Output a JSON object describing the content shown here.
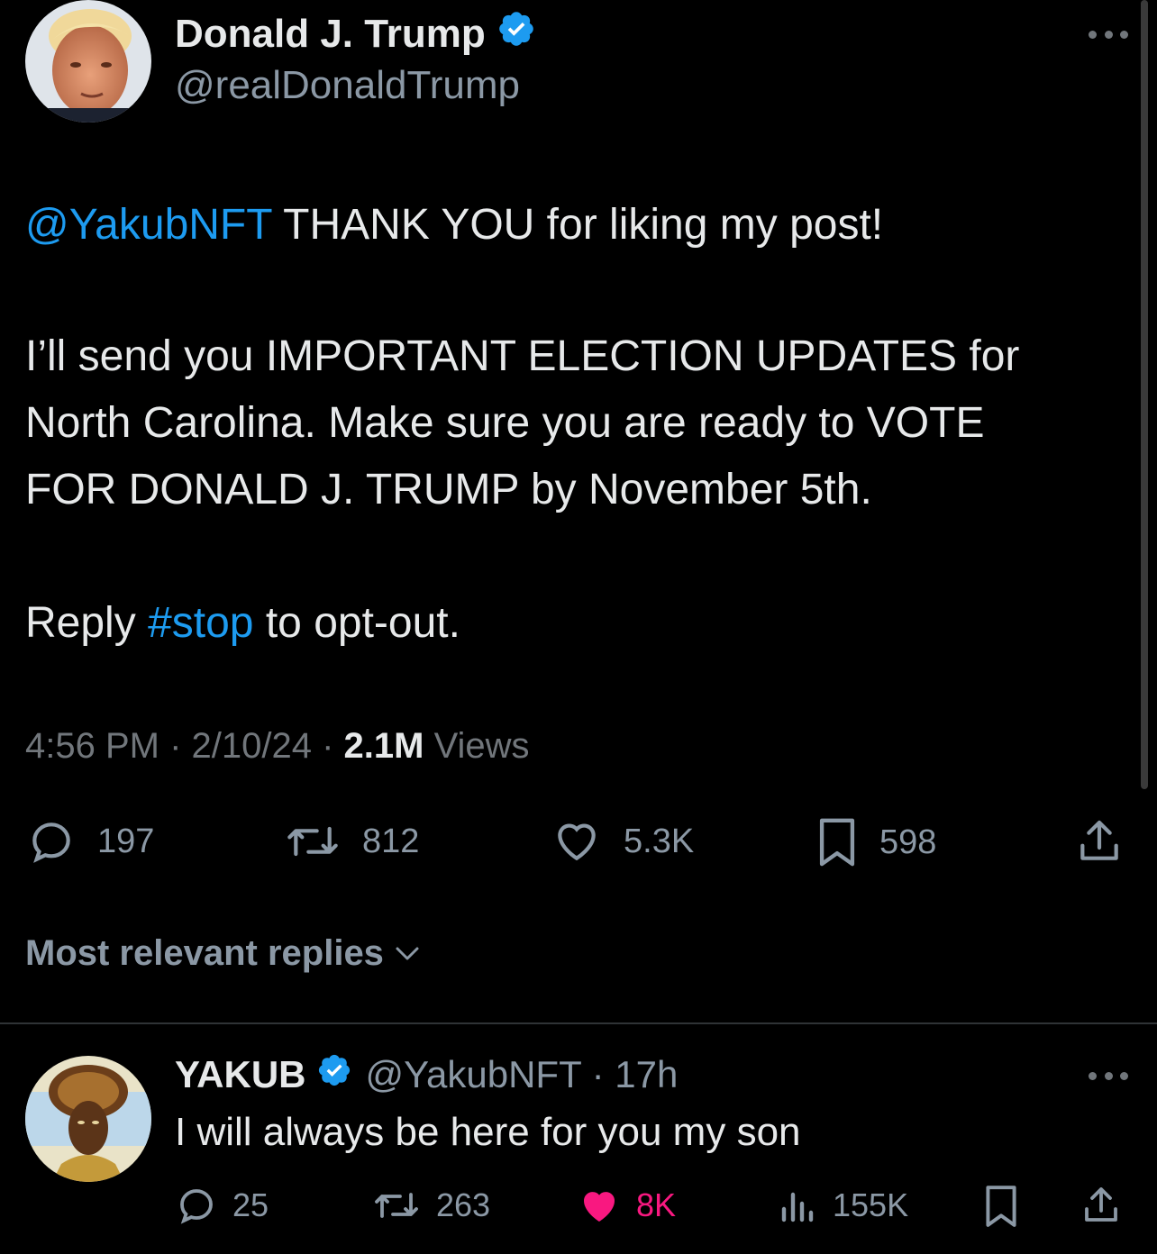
{
  "tweet": {
    "author": {
      "display_name": "Donald J. Trump",
      "handle": "@realDonaldTrump",
      "verified": true,
      "avatar": "profile-photo-trump"
    },
    "body": {
      "line1": {
        "mention": "@YakubNFT",
        "text": " THANK YOU for liking my post!"
      },
      "line2": "I’ll send you IMPORTANT ELECTION UPDATES for",
      "line3": "North Carolina. Make sure you are ready to VOTE",
      "line4": "FOR DONALD J. TRUMP by November 5th.",
      "line5": {
        "prefix": "Reply ",
        "hashtag": "#stop",
        "suffix": " to opt-out."
      }
    },
    "meta": {
      "time": "4:56 PM",
      "sep1": " · ",
      "date": "2/10/24",
      "sep2": " · ",
      "views_count": "2.1M",
      "views_label": " Views"
    },
    "actions": {
      "replies": "197",
      "reposts": "812",
      "likes": "5.3K",
      "bookmarks": "598"
    }
  },
  "replies_section": {
    "title": "Most relevant replies"
  },
  "reply": {
    "display_name": "YAKUB",
    "verified": true,
    "handle_time": "@YakubNFT · 17h",
    "text": "I will always be here for you my son",
    "avatar": "profile-photo-yakub",
    "actions": {
      "replies": "25",
      "reposts": "263",
      "likes": "8K",
      "views": "155K"
    }
  },
  "colors": {
    "background": "#000000",
    "text": "#e7e9ea",
    "secondary": "#8b98a5",
    "link": "#1d9bf0",
    "like_active": "#f91880",
    "divider": "#2f3336"
  }
}
